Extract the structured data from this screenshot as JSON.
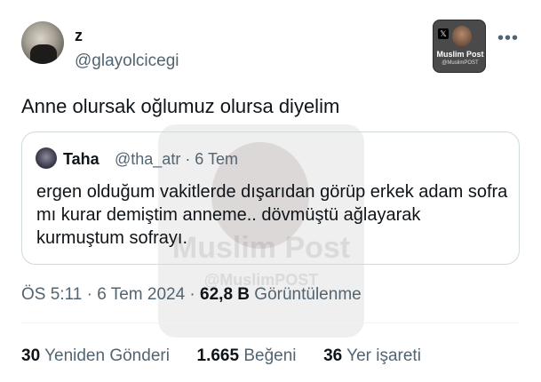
{
  "author": {
    "display_name": "z",
    "handle": "@glayolcicegi"
  },
  "watermark": {
    "x_mark": "𝕏",
    "title": "Muslim Post",
    "sub": "@MuslimPOST"
  },
  "tweet": {
    "text": "Anne olursak oğlumuz olursa diyelim"
  },
  "quote": {
    "name": "Taha",
    "handle_and_time": "@tha_atr · 6 Tem",
    "text": "ergen olduğum vakitlerde dışarıdan görüp erkek adam sofra mı kurar demiştim anneme.. dövmüştü ağlayarak kurmuştum sofrayı."
  },
  "meta": {
    "time": "ÖS 5:11",
    "sep1": " · ",
    "date": "6 Tem 2024",
    "sep2": " · ",
    "views_count": "62,8 B",
    "views_label": " Görüntülenme"
  },
  "stats": {
    "reposts_count": "30",
    "reposts_label": " Yeniden Gönderi",
    "likes_count": "1.665",
    "likes_label": " Beğeni",
    "bookmarks_count": "36",
    "bookmarks_label": " Yer işareti"
  },
  "icons": {
    "more": "more-horizontal-icon"
  }
}
